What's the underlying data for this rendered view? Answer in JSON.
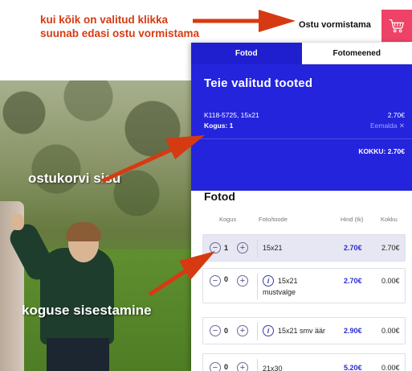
{
  "annotations": {
    "top_line1": "kui kõik on valitud klikka",
    "top_line2": "suunab edasi ostu vormistama",
    "cart_contents": "ostukorvi sisu",
    "quantity_entry": "koguse sisestamine"
  },
  "header": {
    "checkout_label": "Ostu vormistama",
    "cart_icon": "shopping-cart-icon",
    "cart_color": "#ee4266"
  },
  "tabs": [
    {
      "label": "Fotod",
      "active": true
    },
    {
      "label": "Fotomeened",
      "active": false
    }
  ],
  "selected": {
    "title": "Teie valitud tooted",
    "item_line": "K118-5725, 15x21",
    "item_qty": "Kogus: 1",
    "item_price": "2.70€",
    "remove_label": "Eemalda ✕",
    "total": "KOKKU: 2.70€",
    "accent": "#2424dd"
  },
  "photos_section": {
    "title": "Fotod",
    "columns": [
      "Kogus",
      "Foto/toode",
      "Hind (tk)",
      "Kokku"
    ],
    "rows": [
      {
        "qty": "1",
        "product": "15x21",
        "product_line2": "",
        "info": false,
        "price": "2.70€",
        "total": "2.70€"
      },
      {
        "qty": "0",
        "product": "15x21",
        "product_line2": "mustvalge",
        "info": true,
        "price": "2.70€",
        "total": "0.00€"
      },
      {
        "qty": "0",
        "product": "15x21 smv äär",
        "product_line2": "",
        "info": true,
        "price": "2.90€",
        "total": "0.00€"
      },
      {
        "qty": "0",
        "product": "21x30",
        "product_line2": "",
        "info": false,
        "price": "5.20€",
        "total": "0.00€"
      }
    ]
  }
}
